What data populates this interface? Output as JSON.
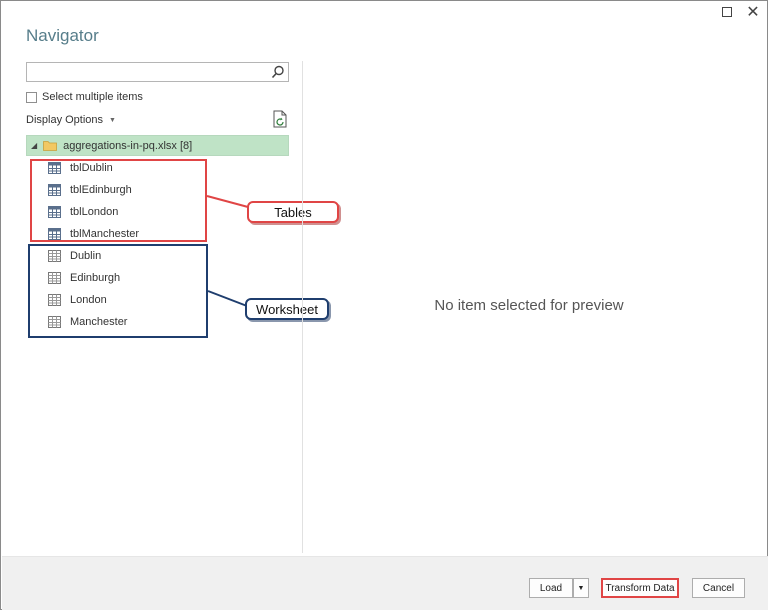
{
  "window": {
    "title": "Navigator",
    "maximize_icon": "maximize-icon",
    "close_glyph": "✕"
  },
  "left_pane": {
    "search": {
      "value": "",
      "placeholder": ""
    },
    "select_multiple": {
      "label": "Select multiple items",
      "checked": false
    },
    "display_options": {
      "label": "Display Options"
    },
    "tree": {
      "root": {
        "label": "aggregations-in-pq.xlsx [8]",
        "expanded": true
      },
      "tables": [
        "tblDublin",
        "tblEdinburgh",
        "tblLondon",
        "tblManchester"
      ],
      "worksheets": [
        "Dublin",
        "Edinburgh",
        "London",
        "Manchester"
      ]
    }
  },
  "annotations": {
    "tables_label": "Tables",
    "worksheet_label": "Worksheet",
    "tables_color": "#e04545",
    "worksheet_color": "#1f3e6e"
  },
  "preview": {
    "empty_message": "No item selected for preview"
  },
  "footer": {
    "load_label": "Load",
    "transform_label": "Transform Data",
    "cancel_label": "Cancel"
  },
  "colors": {
    "title": "#567d8a",
    "selected_row": "#bfe3c6"
  }
}
